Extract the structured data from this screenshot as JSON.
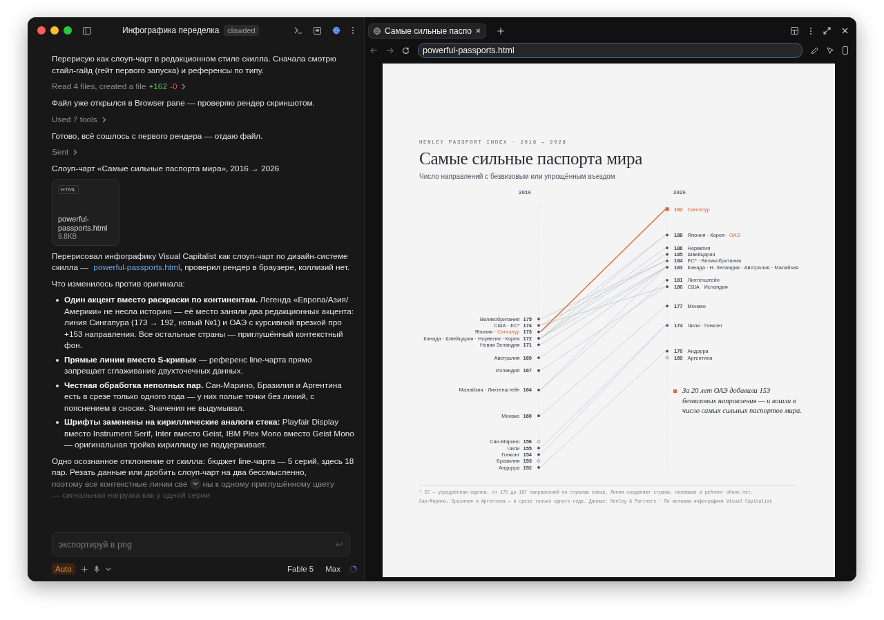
{
  "app": {
    "title": "Инфографика переделка",
    "badge": "clawded"
  },
  "chat": {
    "messages": [
      {
        "kind": "text",
        "text": "Перерисую как слоуп-чарт в редакционном стиле скилла. Сначала смотрю стайл-гайд (гейт первого запуска) и референсы по типу."
      },
      {
        "kind": "activity",
        "text": "Read 4 files, created a file",
        "added": "+162",
        "removed": "-0"
      },
      {
        "kind": "text",
        "text": "Файл уже открылся в Browser pane — проверяю рендер скриншотом."
      },
      {
        "kind": "activity",
        "text": "Used 7 tools"
      },
      {
        "kind": "text",
        "text": "Готово, всё сошлось с первого рендера — отдаю файл."
      },
      {
        "kind": "activity",
        "text": "Sent"
      },
      {
        "kind": "text",
        "text": "Слоуп-чарт «Самые сильные паспорта мира», 2016 → 2026"
      },
      {
        "kind": "file",
        "type": "HTML",
        "name": "powerful-passports.html",
        "size": "9.8KB"
      },
      {
        "kind": "link_text",
        "before": "Перерисовал инфографику Visual Capitalist как слоуп-чарт по дизайн-системе скилла — ",
        "link": "powerful-passports.html",
        "after": ", проверил рендер в браузере, коллизий нет."
      },
      {
        "kind": "text",
        "text": "Что изменилось против оригинала:"
      },
      {
        "kind": "list",
        "items": [
          "**Один акцент вместо раскраски по континентам.** Легенда «Европа/Азия/Америки» не несла историю — её место заняли два редакционных акцента: линия Сингапура (173 → 192, новый №1) и ОАЭ с курсивной врезкой про +153 направления. Все остальные страны — приглушённый контекстный фон.",
          "**Прямые линии вместо S-кривых** — референс line-чарта прямо запрещает сглаживание двухточечных данных.",
          "**Честная обработка неполных пар.** Сан-Марино, Бразилия и Аргентина есть в срезе только одного года — у них полые точки без линий, с пояснением в сноске. Значения не выдумывал.",
          "**Шрифты заменены на кириллические аналоги стека:** Playfair Display вместо Instrument Serif, Inter вместо Geist, IBM Plex Mono вместо Geist Mono — оригинальная тройка кириллицу не поддерживает."
        ]
      },
      {
        "kind": "fading",
        "text": "Одно осознанное отклонение от скилла: бюджет line-чарта — 5 серий, здесь 18 пар. Резать данные или дробить слоуп-чарт на два бессмысленно,",
        "before_button": "поэтому все контекстные линии све",
        "after_button": "ны к одному приглушённому цвету",
        "faded": "— сигнальная нагрузка как у одной серии"
      }
    ]
  },
  "composer": {
    "placeholder": "экспортируй в png",
    "mode": "Auto",
    "model": "Fable 5",
    "effort": "Max"
  },
  "browser": {
    "tabs": [
      {
        "title": "Самые сильные паспо",
        "selected": true
      }
    ],
    "url": "powerful-passports.html"
  },
  "page": {
    "kicker": "HENLEY PASSPORT INDEX · 2016 → 2026",
    "title": "Самые сильные паспорта мира",
    "subtitle": "Число направлений с безвизовым или упрощённым въездом",
    "slope_chart": {
      "years": [
        "2016",
        "2026"
      ],
      "left": [
        {
          "value": "175",
          "hollow": false,
          "highlighted": false,
          "parts": [
            {
              "text": "Великобритания",
              "accent": false
            }
          ]
        },
        {
          "value": "174",
          "hollow": false,
          "highlighted": false,
          "parts": [
            {
              "text": "США · ЕС*",
              "accent": false
            }
          ]
        },
        {
          "value": "173",
          "hollow": false,
          "highlighted": false,
          "parts": [
            {
              "text": "Япония · ",
              "accent": false
            },
            {
              "text": "Сингапур",
              "accent": true
            }
          ]
        },
        {
          "value": "172",
          "hollow": false,
          "highlighted": false,
          "parts": [
            {
              "text": "Канада · Швейцария · Норвегия · Корея",
              "accent": false
            }
          ]
        },
        {
          "value": "171",
          "hollow": false,
          "highlighted": false,
          "parts": [
            {
              "text": "Новая Зеландия",
              "accent": false
            }
          ]
        },
        {
          "value": "169",
          "hollow": false,
          "highlighted": false,
          "parts": [
            {
              "text": "Австралия",
              "accent": false
            }
          ]
        },
        {
          "value": "167",
          "hollow": false,
          "highlighted": false,
          "parts": [
            {
              "text": "Исландия",
              "accent": false
            }
          ]
        },
        {
          "value": "164",
          "hollow": false,
          "highlighted": false,
          "parts": [
            {
              "text": "Малайзия · Лихтенштейн",
              "accent": false
            }
          ]
        },
        {
          "value": "160",
          "hollow": false,
          "highlighted": false,
          "parts": [
            {
              "text": "Монако",
              "accent": false
            }
          ]
        },
        {
          "value": "156",
          "hollow": true,
          "highlighted": false,
          "parts": [
            {
              "text": "Сан-Марино",
              "accent": false
            }
          ]
        },
        {
          "value": "155",
          "hollow": false,
          "highlighted": false,
          "parts": [
            {
              "text": "Чили",
              "accent": false
            }
          ]
        },
        {
          "value": "154",
          "hollow": false,
          "highlighted": false,
          "parts": [
            {
              "text": "Гонконг",
              "accent": false
            }
          ]
        },
        {
          "value": "153",
          "hollow": true,
          "highlighted": false,
          "parts": [
            {
              "text": "Бразилия",
              "accent": false
            }
          ]
        },
        {
          "value": "152",
          "hollow": false,
          "highlighted": false,
          "parts": [
            {
              "text": "Андорра",
              "accent": false
            }
          ]
        }
      ],
      "right": [
        {
          "value": "192",
          "hollow": false,
          "highlighted": true,
          "parts": [
            {
              "text": "Сингапур",
              "accent": true
            }
          ]
        },
        {
          "value": "188",
          "hollow": false,
          "highlighted": false,
          "parts": [
            {
              "text": "Япония · Корея · ",
              "accent": false
            },
            {
              "text": "ОАЭ",
              "accent": true
            }
          ]
        },
        {
          "value": "186",
          "hollow": false,
          "highlighted": false,
          "parts": [
            {
              "text": "Норвегия",
              "accent": false
            }
          ]
        },
        {
          "value": "185",
          "hollow": false,
          "highlighted": false,
          "parts": [
            {
              "text": "Швейцария",
              "accent": false
            }
          ]
        },
        {
          "value": "184",
          "hollow": false,
          "highlighted": false,
          "parts": [
            {
              "text": "ЕС* · Великобритания",
              "accent": false
            }
          ]
        },
        {
          "value": "183",
          "hollow": false,
          "highlighted": false,
          "parts": [
            {
              "text": "Канада · Н. Зеландия · Австралия · Малайзия",
              "accent": false
            }
          ]
        },
        {
          "value": "181",
          "hollow": false,
          "highlighted": false,
          "parts": [
            {
              "text": "Лихтенштейн",
              "accent": false
            }
          ]
        },
        {
          "value": "180",
          "hollow": false,
          "highlighted": false,
          "parts": [
            {
              "text": "США · Исландия",
              "accent": false
            }
          ]
        },
        {
          "value": "177",
          "hollow": false,
          "highlighted": false,
          "parts": [
            {
              "text": "Монако",
              "accent": false
            }
          ]
        },
        {
          "value": "174",
          "hollow": false,
          "highlighted": false,
          "parts": [
            {
              "text": "Чили · Гонконг",
              "accent": false
            }
          ]
        },
        {
          "value": "170",
          "hollow": false,
          "highlighted": false,
          "parts": [
            {
              "text": "Андорра",
              "accent": false
            }
          ]
        },
        {
          "value": "169",
          "hollow": true,
          "highlighted": false,
          "parts": [
            {
              "text": "Аргентина",
              "accent": false
            }
          ]
        }
      ]
    },
    "note": "За 20 лет ОАЭ добавили 153 безвизовых направления — и вошли в число самых сильных паспортов мира.",
    "footnotes": [
      "* ЕС — усреднённая оценка: от 175 до 187 направлений по странам союза. Линии соединяют страны, попавшие в рейтинг обоих лет.",
      "Сан-Марино, Бразилия и Аргентина — в срезе только одного года. Данные: Henley & Partners · По мотивам инфографики Visual Capitalist"
    ]
  }
}
